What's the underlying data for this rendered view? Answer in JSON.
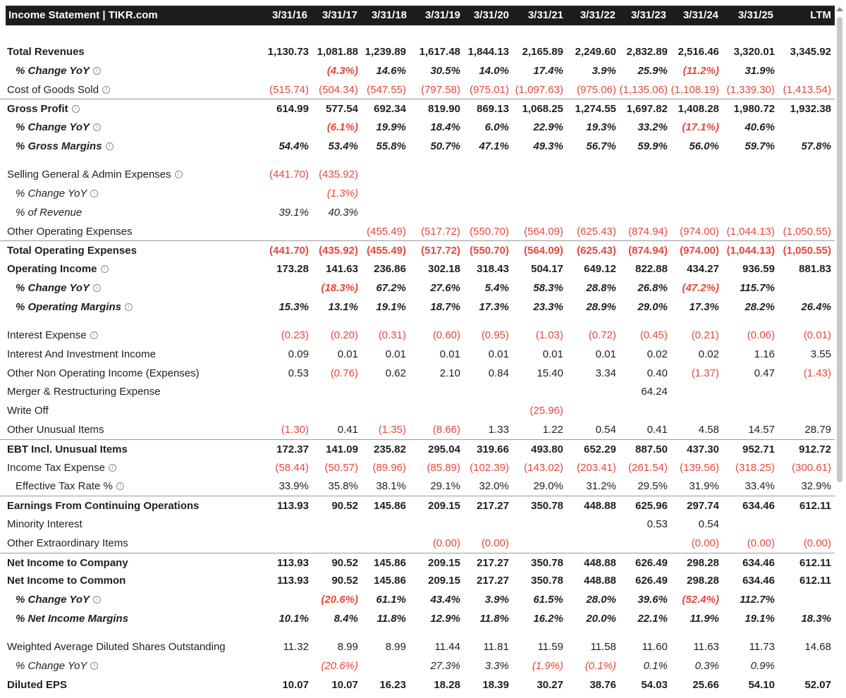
{
  "header": {
    "title": "Income Statement | TIKR.com",
    "columns": [
      "3/31/16",
      "3/31/17",
      "3/31/18",
      "3/31/19",
      "3/31/20",
      "3/31/21",
      "3/31/22",
      "3/31/23",
      "3/31/24",
      "3/31/25",
      "LTM"
    ]
  },
  "rows": [
    {
      "label": "Total Revenues",
      "bold": true,
      "values": [
        "1,130.73",
        "1,081.88",
        "1,239.89",
        "1,617.48",
        "1,844.13",
        "2,165.89",
        "2,249.60",
        "2,832.89",
        "2,516.46",
        "3,320.01",
        "3,345.92"
      ]
    },
    {
      "label": "% Change YoY",
      "bold": true,
      "italic": true,
      "info": true,
      "indent": true,
      "values": [
        "",
        "(4.3%)",
        "14.6%",
        "30.5%",
        "14.0%",
        "17.4%",
        "3.9%",
        "25.9%",
        "(11.2%)",
        "31.9%",
        ""
      ]
    },
    {
      "label": "Cost of Goods Sold",
      "info": true,
      "values": [
        "(515.74)",
        "(504.34)",
        "(547.55)",
        "(797.58)",
        "(975.01)",
        "(1,097.63)",
        "(975.06)",
        "(1,135.06)",
        "(1,108.19)",
        "(1,339.30)",
        "(1,413.54)"
      ]
    },
    {
      "label": "Gross Profit",
      "bold": true,
      "info": true,
      "sep": true,
      "values": [
        "614.99",
        "577.54",
        "692.34",
        "819.90",
        "869.13",
        "1,068.25",
        "1,274.55",
        "1,697.82",
        "1,408.28",
        "1,980.72",
        "1,932.38"
      ]
    },
    {
      "label": "% Change YoY",
      "bold": true,
      "italic": true,
      "info": true,
      "indent": true,
      "values": [
        "",
        "(6.1%)",
        "19.9%",
        "18.4%",
        "6.0%",
        "22.9%",
        "19.3%",
        "33.2%",
        "(17.1%)",
        "40.6%",
        ""
      ]
    },
    {
      "label": "% Gross Margins",
      "bold": true,
      "italic": true,
      "info": true,
      "indent": true,
      "values": [
        "54.4%",
        "53.4%",
        "55.8%",
        "50.7%",
        "47.1%",
        "49.3%",
        "56.7%",
        "59.9%",
        "56.0%",
        "59.7%",
        "57.8%"
      ]
    },
    {
      "label": "Selling General & Admin Expenses",
      "info": true,
      "gap": true,
      "values": [
        "(441.70)",
        "(435.92)",
        "",
        "",
        "",
        "",
        "",
        "",
        "",
        "",
        ""
      ]
    },
    {
      "label": "% Change YoY",
      "italic": true,
      "info": true,
      "indent": true,
      "values": [
        "",
        "(1.3%)",
        "",
        "",
        "",
        "",
        "",
        "",
        "",
        "",
        ""
      ]
    },
    {
      "label": "% of Revenue",
      "italic": true,
      "indent": true,
      "values": [
        "39.1%",
        "40.3%",
        "",
        "",
        "",
        "",
        "",
        "",
        "",
        "",
        ""
      ]
    },
    {
      "label": "Other Operating Expenses",
      "values": [
        "",
        "",
        "(455.49)",
        "(517.72)",
        "(550.70)",
        "(564.09)",
        "(625.43)",
        "(874.94)",
        "(974.00)",
        "(1,044.13)",
        "(1,050.55)"
      ]
    },
    {
      "label": "Total Operating Expenses",
      "bold": true,
      "sep": true,
      "values": [
        "(441.70)",
        "(435.92)",
        "(455.49)",
        "(517.72)",
        "(550.70)",
        "(564.09)",
        "(625.43)",
        "(874.94)",
        "(974.00)",
        "(1,044.13)",
        "(1,050.55)"
      ]
    },
    {
      "label": "Operating Income",
      "bold": true,
      "info": true,
      "values": [
        "173.28",
        "141.63",
        "236.86",
        "302.18",
        "318.43",
        "504.17",
        "649.12",
        "822.88",
        "434.27",
        "936.59",
        "881.83"
      ]
    },
    {
      "label": "% Change YoY",
      "bold": true,
      "italic": true,
      "info": true,
      "indent": true,
      "values": [
        "",
        "(18.3%)",
        "67.2%",
        "27.6%",
        "5.4%",
        "58.3%",
        "28.8%",
        "26.8%",
        "(47.2%)",
        "115.7%",
        ""
      ]
    },
    {
      "label": "% Operating Margins",
      "bold": true,
      "italic": true,
      "info": true,
      "indent": true,
      "values": [
        "15.3%",
        "13.1%",
        "19.1%",
        "18.7%",
        "17.3%",
        "23.3%",
        "28.9%",
        "29.0%",
        "17.3%",
        "28.2%",
        "26.4%"
      ]
    },
    {
      "label": "Interest Expense",
      "info": true,
      "gap": true,
      "values": [
        "(0.23)",
        "(0.20)",
        "(0.31)",
        "(0.60)",
        "(0.95)",
        "(1.03)",
        "(0.72)",
        "(0.45)",
        "(0.21)",
        "(0.06)",
        "(0.01)"
      ]
    },
    {
      "label": "Interest And Investment Income",
      "values": [
        "0.09",
        "0.01",
        "0.01",
        "0.01",
        "0.01",
        "0.01",
        "0.01",
        "0.02",
        "0.02",
        "1.16",
        "3.55"
      ]
    },
    {
      "label": "Other Non Operating Income (Expenses)",
      "values": [
        "0.53",
        "(0.76)",
        "0.62",
        "2.10",
        "0.84",
        "15.40",
        "3.34",
        "0.40",
        "(1.37)",
        "0.47",
        "(1.43)"
      ]
    },
    {
      "label": "Merger & Restructuring Expense",
      "values": [
        "",
        "",
        "",
        "",
        "",
        "",
        "",
        "64.24",
        "",
        "",
        ""
      ]
    },
    {
      "label": "Write Off",
      "values": [
        "",
        "",
        "",
        "",
        "",
        "(25.96)",
        "",
        "",
        "",
        "",
        ""
      ]
    },
    {
      "label": "Other Unusual Items",
      "values": [
        "(1.30)",
        "0.41",
        "(1.35)",
        "(8.66)",
        "1.33",
        "1.22",
        "0.54",
        "0.41",
        "4.58",
        "14.57",
        "28.79"
      ]
    },
    {
      "label": "EBT Incl. Unusual Items",
      "bold": true,
      "sep": true,
      "values": [
        "172.37",
        "141.09",
        "235.82",
        "295.04",
        "319.66",
        "493.80",
        "652.29",
        "887.50",
        "437.30",
        "952.71",
        "912.72"
      ]
    },
    {
      "label": "Income Tax Expense",
      "info": true,
      "values": [
        "(58.44)",
        "(50.57)",
        "(89.96)",
        "(85.89)",
        "(102.39)",
        "(143.02)",
        "(203.41)",
        "(261.54)",
        "(139.56)",
        "(318.25)",
        "(300.61)"
      ]
    },
    {
      "label": "Effective Tax Rate %",
      "info": true,
      "indent": true,
      "values": [
        "33.9%",
        "35.8%",
        "38.1%",
        "29.1%",
        "32.0%",
        "29.0%",
        "31.2%",
        "29.5%",
        "31.9%",
        "33.4%",
        "32.9%"
      ]
    },
    {
      "label": "Earnings From Continuing Operations",
      "bold": true,
      "sep": true,
      "values": [
        "113.93",
        "90.52",
        "145.86",
        "209.15",
        "217.27",
        "350.78",
        "448.88",
        "625.96",
        "297.74",
        "634.46",
        "612.11"
      ]
    },
    {
      "label": "Minority Interest",
      "values": [
        "",
        "",
        "",
        "",
        "",
        "",
        "",
        "0.53",
        "0.54",
        "",
        ""
      ]
    },
    {
      "label": "Other Extraordinary Items",
      "values": [
        "",
        "",
        "",
        "(0.00)",
        "(0.00)",
        "",
        "",
        "",
        "(0.00)",
        "(0.00)",
        "(0.00)"
      ]
    },
    {
      "label": "Net Income to Company",
      "bold": true,
      "sep": true,
      "values": [
        "113.93",
        "90.52",
        "145.86",
        "209.15",
        "217.27",
        "350.78",
        "448.88",
        "626.49",
        "298.28",
        "634.46",
        "612.11"
      ]
    },
    {
      "label": "Net Income to Common",
      "bold": true,
      "values": [
        "113.93",
        "90.52",
        "145.86",
        "209.15",
        "217.27",
        "350.78",
        "448.88",
        "626.49",
        "298.28",
        "634.46",
        "612.11"
      ]
    },
    {
      "label": "% Change YoY",
      "bold": true,
      "italic": true,
      "info": true,
      "indent": true,
      "values": [
        "",
        "(20.6%)",
        "61.1%",
        "43.4%",
        "3.9%",
        "61.5%",
        "28.0%",
        "39.6%",
        "(52.4%)",
        "112.7%",
        ""
      ]
    },
    {
      "label": "% Net Income Margins",
      "bold": true,
      "italic": true,
      "indent": true,
      "values": [
        "10.1%",
        "8.4%",
        "11.8%",
        "12.9%",
        "11.8%",
        "16.2%",
        "20.0%",
        "22.1%",
        "11.9%",
        "19.1%",
        "18.3%"
      ]
    },
    {
      "label": "Weighted Average Diluted Shares Outstanding",
      "gap": true,
      "values": [
        "11.32",
        "8.99",
        "8.99",
        "11.44",
        "11.81",
        "11.59",
        "11.58",
        "11.60",
        "11.63",
        "11.73",
        "14.68"
      ]
    },
    {
      "label": "% Change YoY",
      "italic": true,
      "info": true,
      "indent": true,
      "values": [
        "",
        "(20.6%)",
        "",
        "27.3%",
        "3.3%",
        "(1.9%)",
        "(0.1%)",
        "0.1%",
        "0.3%",
        "0.9%",
        ""
      ]
    },
    {
      "label": "Diluted EPS",
      "bold": true,
      "values": [
        "10.07",
        "10.07",
        "16.23",
        "18.28",
        "18.39",
        "30.27",
        "38.76",
        "54.03",
        "25.66",
        "54.10",
        "52.07"
      ]
    }
  ],
  "colors": {
    "header_bg": "#1d1d1f",
    "negative": "#e5483b",
    "text": "#1f1f1f"
  }
}
